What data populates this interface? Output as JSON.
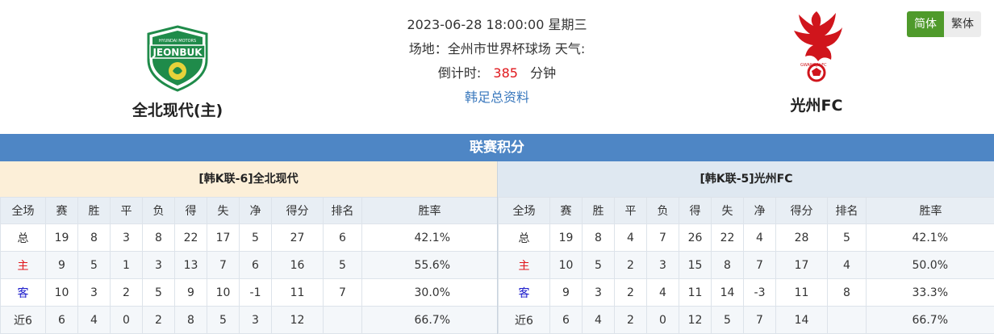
{
  "header": {
    "home_team": {
      "name": "全北现代(主)",
      "logo_text": "JEONBUK",
      "logo_subtext": "HYUNDAI MOTORS"
    },
    "away_team": {
      "name": "光州FC",
      "logo_text": "GWANGJU FC"
    },
    "datetime": "2023-06-28 18:00:00 星期三",
    "venue": "场地：全州市世界杯球场 天气:",
    "countdown_label": "倒计时:",
    "countdown_value": "385",
    "countdown_unit": "分钟",
    "league_link": "韩足总资料"
  },
  "lang": {
    "simplified": "简体",
    "traditional": "繁体"
  },
  "section_title": "联赛积分",
  "columns": [
    "全场",
    "赛",
    "胜",
    "平",
    "负",
    "得",
    "失",
    "净",
    "得分",
    "排名",
    "胜率"
  ],
  "home_table": {
    "title": "[韩K联-6]全北现代",
    "rows": [
      [
        "总",
        "19",
        "8",
        "3",
        "8",
        "22",
        "17",
        "5",
        "27",
        "6",
        "42.1%"
      ],
      [
        "主",
        "9",
        "5",
        "1",
        "3",
        "13",
        "7",
        "6",
        "16",
        "5",
        "55.6%"
      ],
      [
        "客",
        "10",
        "3",
        "2",
        "5",
        "9",
        "10",
        "-1",
        "11",
        "7",
        "30.0%"
      ],
      [
        "近6",
        "6",
        "4",
        "0",
        "2",
        "8",
        "5",
        "3",
        "12",
        "",
        "66.7%"
      ]
    ]
  },
  "away_table": {
    "title": "[韩K联-5]光州FC",
    "rows": [
      [
        "总",
        "19",
        "8",
        "4",
        "7",
        "26",
        "22",
        "4",
        "28",
        "5",
        "42.1%"
      ],
      [
        "主",
        "10",
        "5",
        "2",
        "3",
        "15",
        "8",
        "7",
        "17",
        "4",
        "50.0%"
      ],
      [
        "客",
        "9",
        "3",
        "2",
        "4",
        "11",
        "14",
        "-3",
        "11",
        "8",
        "33.3%"
      ],
      [
        "近6",
        "6",
        "4",
        "2",
        "0",
        "12",
        "5",
        "7",
        "14",
        "",
        "66.7%"
      ]
    ]
  },
  "colors": {
    "accent_green": "#4f9a2b",
    "section_blue": "#4e86c5",
    "home_red": "#e0161b",
    "away_blue": "#1a1acb",
    "link": "#3a78bd"
  }
}
